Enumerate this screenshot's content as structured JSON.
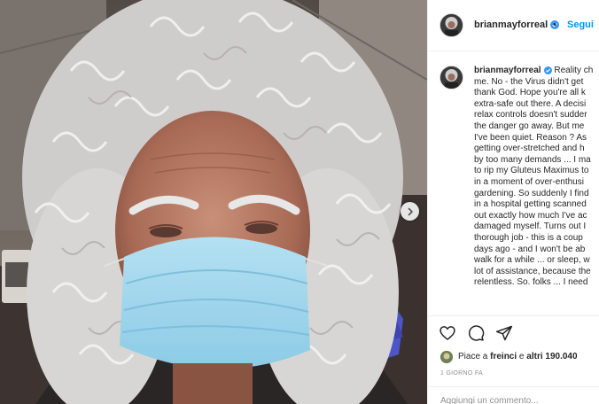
{
  "post": {
    "username": "brianmayforreal",
    "follow_separator": "•",
    "follow_label": "Segui",
    "caption_lines": [
      "Reality ch",
      "me. No - the Virus didn't get",
      "thank God. Hope you're all k",
      "extra-safe out there. A decisi",
      "relax controls doesn't sudder",
      "the danger go away. But me",
      "I've been quiet. Reason ? As",
      "getting over-stretched and h",
      "by too many demands ... I ma",
      "to rip my Gluteus Maximus to",
      "in a moment of over-enthusi",
      "gardening. So suddenly I find",
      "in a hospital getting scanned",
      "out exactly how much I've ac",
      "damaged myself. Turns out I",
      "thorough job - this is a coup",
      "days ago - and I won't be ab",
      "walk for a while ... or sleep, w",
      "lot of assistance, because the",
      "relentless. So. folks ... I need"
    ],
    "likes": {
      "prefix": "Piace a ",
      "first_user": "freinci",
      "middle": " e ",
      "others": "altri 190.040"
    },
    "timestamp": "1 GIORNO FA",
    "comment_placeholder": "Aggiungi un commento..."
  },
  "icons": {
    "verified": "verified-badge-icon",
    "like": "heart-icon",
    "comment": "comment-icon",
    "share": "paper-plane-icon",
    "next": "chevron-right-icon"
  },
  "colors": {
    "link_blue": "#0095f6",
    "mask_blue": "#9fd3ea",
    "scrub_blue": "#4d56c7",
    "hair": "#dedede"
  }
}
